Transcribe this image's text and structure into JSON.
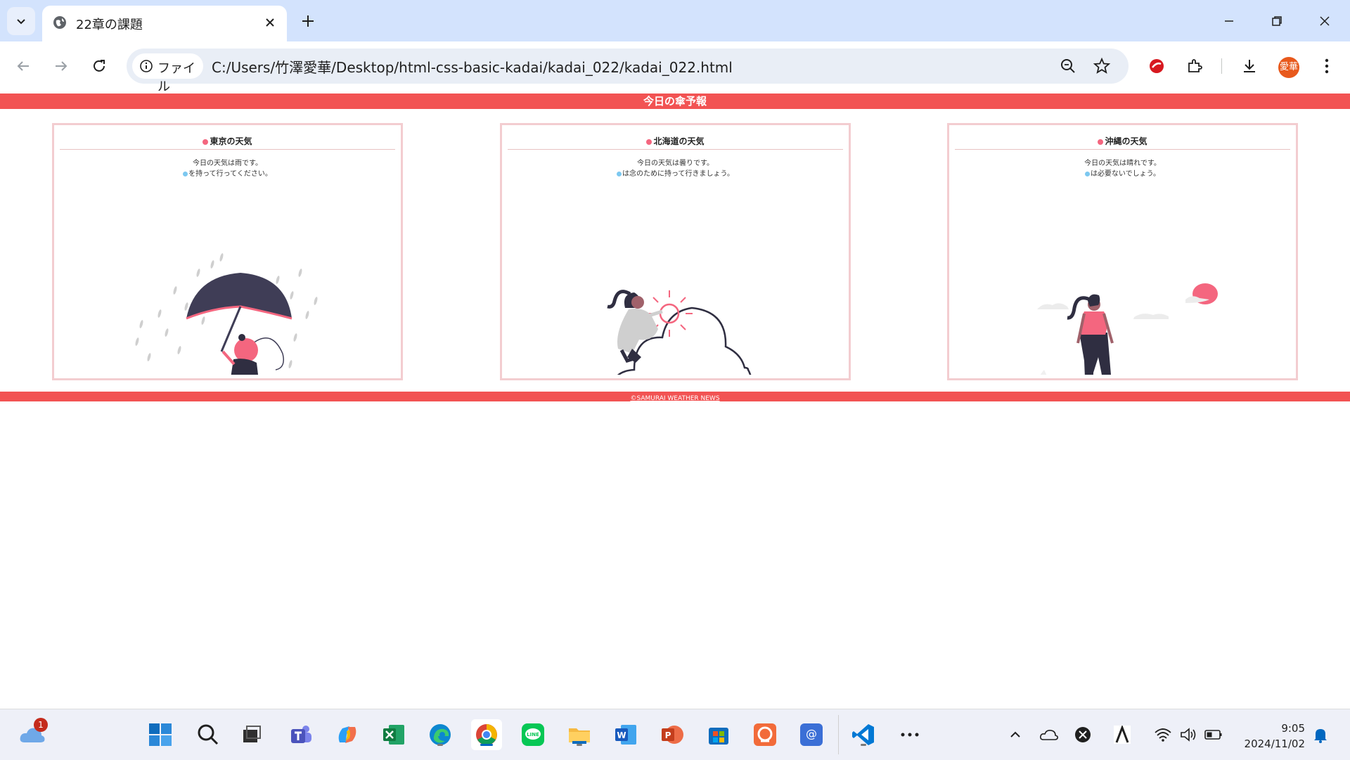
{
  "browser": {
    "tab_title": "22章の課題",
    "chip_label": "ファイル",
    "url": "C:/Users/竹澤愛華/Desktop/html-css-basic-kadai/kadai_022/kadai_022.html",
    "profile_initials": "愛華"
  },
  "page": {
    "header": "今日の傘予報",
    "cards": [
      {
        "title": "東京の天気",
        "line1": "今日の天気は雨です。",
        "line2": "を持って行ってください。",
        "illustration": "rain-umbrella"
      },
      {
        "title": "北海道の天気",
        "line1": "今日の天気は曇りです。",
        "line2": "は念のために持って行きましょう。",
        "illustration": "cloud-sun"
      },
      {
        "title": "沖縄の天気",
        "line1": "今日の天気は晴れです。",
        "line2": "は必要ないでしょう。",
        "illustration": "sunny-walk"
      }
    ],
    "footer": "©SAMURAI WEATHER NEWS"
  },
  "taskbar": {
    "weather_badge": "1",
    "time": "9:05",
    "date": "2024/11/02"
  },
  "colors": {
    "accent": "#f25353",
    "card_border": "#f3cdd0",
    "pink": "#f4667f"
  }
}
